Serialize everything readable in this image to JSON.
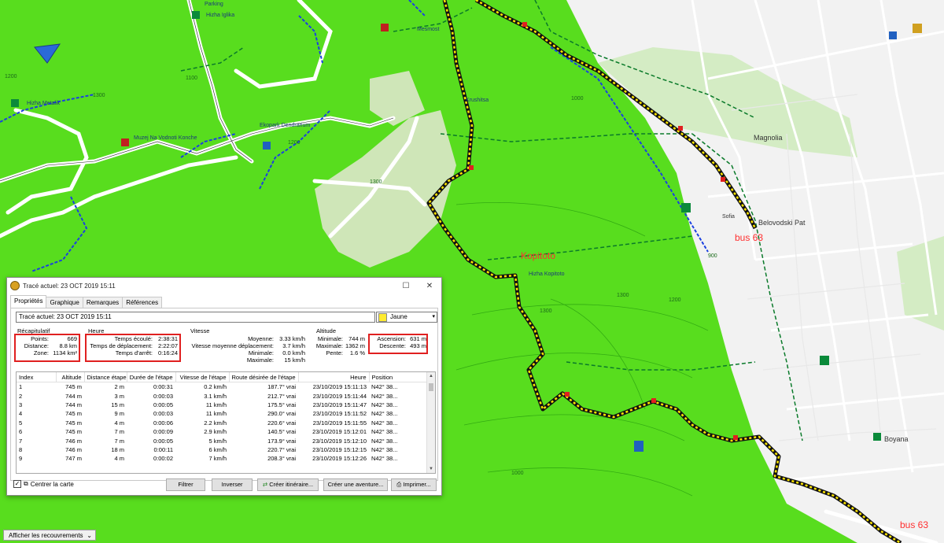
{
  "map": {
    "labels_red": [
      {
        "id": "kopitoto",
        "text": "Kopitoto"
      },
      {
        "id": "bus-upper",
        "text": "bus 63"
      },
      {
        "id": "bus-lower",
        "text": "bus 63"
      }
    ],
    "labels_small": [
      {
        "id": "parking",
        "text": "Parking"
      },
      {
        "id": "hizha-iglika",
        "text": "Hizha Iglika"
      },
      {
        "id": "hizha-metalik",
        "text": "Hizha Metalik"
      },
      {
        "id": "muzej",
        "text": "Muzej Na Vodnoti Konche"
      },
      {
        "id": "ekopark",
        "text": "Ekopark Dendrarium"
      },
      {
        "id": "kopitoto-poi",
        "text": "Hizha Kopitoto"
      },
      {
        "id": "magnolia",
        "text": "Magnolia"
      },
      {
        "id": "belovodski",
        "text": "Belovodski Pat"
      },
      {
        "id": "sofia",
        "text": "Sofia"
      },
      {
        "id": "boyana",
        "text": "Boyana"
      },
      {
        "id": "mesmost",
        "text": "Mesmost"
      },
      {
        "id": "krushitsa",
        "text": "Krushitsa"
      }
    ],
    "contours": [
      "1300",
      "1200",
      "1300",
      "1200",
      "1300",
      "1000",
      "1200",
      "1300",
      "1000",
      "900",
      "1100"
    ]
  },
  "dialog": {
    "title": "Tracé actuel: 23 OCT 2019 15:11",
    "tabs": [
      "Propriétés",
      "Graphique",
      "Remarques",
      "Références"
    ],
    "active_tab": "Propriétés",
    "name_value": "Tracé actuel: 23 OCT 2019 15:11",
    "color_value": "Jaune",
    "recap": {
      "title": "Récapitulatif",
      "points_label": "Points:",
      "points": "669",
      "distance_label": "Distance:",
      "distance": "8.8 km",
      "zone_label": "Zone:",
      "zone": "1134 km²"
    },
    "heure": {
      "title": "Heure",
      "ecoule_label": "Temps écoulé:",
      "ecoule": "2:38:31",
      "deplacement_label": "Temps de déplacement:",
      "deplacement": "2:22:07",
      "arret_label": "Temps d'arrêt:",
      "arret": "0:16:24"
    },
    "vitesse": {
      "title": "Vitesse",
      "moyenne_label": "Moyenne:",
      "moyenne": "3.33 km/h",
      "moy_depl_label": "Vitesse moyenne déplacement:",
      "moy_depl": "3.7 km/h",
      "min_label": "Minimale:",
      "min": "0.0 km/h",
      "max_label": "Maximale:",
      "max": "15 km/h"
    },
    "altitude": {
      "title": "Altitude",
      "min_label": "Minimale:",
      "min": "744 m",
      "max_label": "Maximale:",
      "max": "1362 m",
      "pente_label": "Pente:",
      "pente": "1.6 %",
      "ascension_label": "Ascension:",
      "ascension": "631 m",
      "descente_label": "Descente:",
      "descente": "493 m"
    },
    "grid": {
      "headers": [
        "Index",
        "Altitude",
        "Distance étape",
        "Durée de l'étape",
        "Vitesse de l'étape",
        "Route désirée de l'étape",
        "Heure",
        "Position"
      ],
      "rows": [
        [
          "1",
          "745 m",
          "2 m",
          "0:00:31",
          "0.2 km/h",
          "187.7° vrai",
          "23/10/2019 15:11:13",
          "N42° 38..."
        ],
        [
          "2",
          "744 m",
          "3 m",
          "0:00:03",
          "3.1 km/h",
          "212.7° vrai",
          "23/10/2019 15:11:44",
          "N42° 38..."
        ],
        [
          "3",
          "744 m",
          "15 m",
          "0:00:05",
          "11 km/h",
          "175.5° vrai",
          "23/10/2019 15:11:47",
          "N42° 38..."
        ],
        [
          "4",
          "745 m",
          "9 m",
          "0:00:03",
          "11 km/h",
          "290.0° vrai",
          "23/10/2019 15:11:52",
          "N42° 38..."
        ],
        [
          "5",
          "745 m",
          "4 m",
          "0:00:06",
          "2.2 km/h",
          "220.6° vrai",
          "23/10/2019 15:11:55",
          "N42° 38..."
        ],
        [
          "6",
          "745 m",
          "7 m",
          "0:00:09",
          "2.9 km/h",
          "140.5° vrai",
          "23/10/2019 15:12:01",
          "N42° 38..."
        ],
        [
          "7",
          "746 m",
          "7 m",
          "0:00:05",
          "5 km/h",
          "173.9° vrai",
          "23/10/2019 15:12:10",
          "N42° 38..."
        ],
        [
          "8",
          "746 m",
          "18 m",
          "0:00:11",
          "6 km/h",
          "220.7° vrai",
          "23/10/2019 15:12:15",
          "N42° 38..."
        ],
        [
          "9",
          "747 m",
          "4 m",
          "0:00:02",
          "7 km/h",
          "208.3° vrai",
          "23/10/2019 15:12:26",
          "N42° 38..."
        ]
      ]
    },
    "center_map_label": "Centrer la carte",
    "center_map_checked": true,
    "buttons": {
      "filter": "Filtrer",
      "invert": "Inverser",
      "create_route": "Créer itinéraire...",
      "create_adventure": "Créer une aventure...",
      "print": "Imprimer..."
    }
  },
  "overlay_button": "Afficher les recouvrements"
}
